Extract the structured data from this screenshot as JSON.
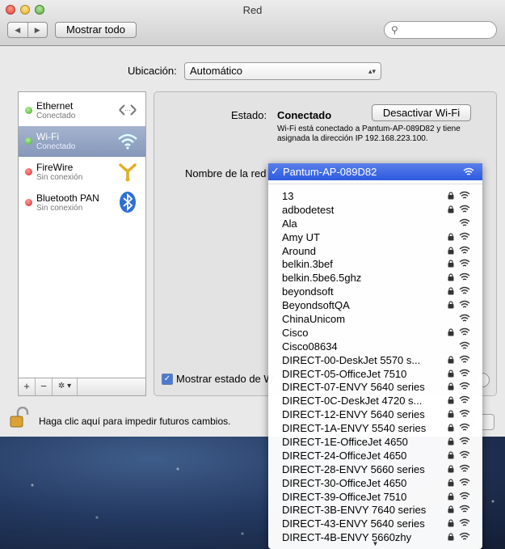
{
  "window": {
    "title": "Red"
  },
  "toolbar": {
    "back": "◀",
    "forward": "▶",
    "show_all": "Mostrar todo",
    "search_placeholder": ""
  },
  "location": {
    "label": "Ubicación:",
    "value": "Automático"
  },
  "services": [
    {
      "name": "Ethernet",
      "status": "Conectado",
      "dot": "green",
      "icon": "ethernet-icon"
    },
    {
      "name": "Wi-Fi",
      "status": "Conectado",
      "dot": "green",
      "icon": "wifi-icon",
      "selected": true
    },
    {
      "name": "FireWire",
      "status": "Sin conexión",
      "dot": "red",
      "icon": "firewire-icon"
    },
    {
      "name": "Bluetooth PAN",
      "status": "Sin conexión",
      "dot": "red",
      "icon": "bluetooth-icon"
    }
  ],
  "sidebar_tools": {
    "add": "+",
    "remove": "−",
    "gear": "✲ ▾"
  },
  "detail": {
    "status_label": "Estado:",
    "status_value": "Conectado",
    "disable_button": "Desactivar Wi-Fi",
    "status_description": "Wi-Fi está conectado a Pantum-AP-089D82 y tiene asignada la dirección IP 192.168.223.100.",
    "network_name_label": "Nombre de la red",
    "show_status_label": "Mostrar estado de W"
  },
  "lock_text": "Haga clic aquí para impedir futuros cambios.",
  "menu": {
    "selected": "Pantum-AP-089D82",
    "networks": [
      {
        "name": "13",
        "locked": true
      },
      {
        "name": "adbodetest",
        "locked": true
      },
      {
        "name": "Ala",
        "locked": false
      },
      {
        "name": "Amy UT",
        "locked": true
      },
      {
        "name": "Around",
        "locked": true
      },
      {
        "name": "belkin.3bef",
        "locked": true
      },
      {
        "name": "belkin.5be6.5ghz",
        "locked": true
      },
      {
        "name": "beyondsoft",
        "locked": true
      },
      {
        "name": "BeyondsoftQA",
        "locked": true
      },
      {
        "name": "ChinaUnicom",
        "locked": false
      },
      {
        "name": "Cisco",
        "locked": true
      },
      {
        "name": "Cisco08634",
        "locked": false
      },
      {
        "name": "DIRECT-00-DeskJet 5570 s...",
        "locked": true
      },
      {
        "name": "DIRECT-05-OfficeJet 7510",
        "locked": true
      },
      {
        "name": "DIRECT-07-ENVY 5640 series",
        "locked": true
      },
      {
        "name": "DIRECT-0C-DeskJet 4720 s...",
        "locked": true
      },
      {
        "name": "DIRECT-12-ENVY 5640 series",
        "locked": true
      },
      {
        "name": "DIRECT-1A-ENVY 5540 series",
        "locked": true
      },
      {
        "name": "DIRECT-1E-OfficeJet 4650",
        "locked": true
      },
      {
        "name": "DIRECT-24-OfficeJet 4650",
        "locked": true
      },
      {
        "name": "DIRECT-28-ENVY 5660 series",
        "locked": true
      },
      {
        "name": "DIRECT-30-OfficeJet 4650",
        "locked": true
      },
      {
        "name": "DIRECT-39-OfficeJet 7510",
        "locked": true
      },
      {
        "name": "DIRECT-3B-ENVY 7640 series",
        "locked": true
      },
      {
        "name": "DIRECT-43-ENVY 5640 series",
        "locked": true
      },
      {
        "name": "DIRECT-4B-ENVY 5660zhy",
        "locked": true
      }
    ],
    "more_indicator": "▼"
  }
}
